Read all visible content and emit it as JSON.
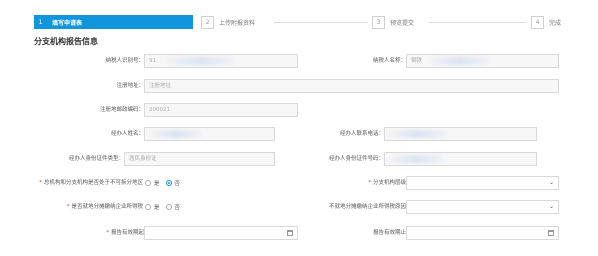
{
  "steps": [
    {
      "num": "1",
      "label": "填写申请表"
    },
    {
      "num": "2",
      "label": "上传附报资料"
    },
    {
      "num": "3",
      "label": "预览提交"
    },
    {
      "num": "4",
      "label": "完成"
    }
  ],
  "section_title": "分支机构报告信息",
  "fields": {
    "taxpayer_id": {
      "label": "纳税人识别号：",
      "prefix": "91"
    },
    "taxpayer_name": {
      "label": "纳税人名称：",
      "prefix": "钢铁"
    },
    "reg_address": {
      "label": "注册地址：",
      "placeholder": "注册地址"
    },
    "postal_code": {
      "label": "注册地邮政编码：",
      "value": "200021"
    },
    "agent_name": {
      "label": "经办人姓名："
    },
    "agent_phone": {
      "label": "经办人联系电话："
    },
    "agent_id_type": {
      "label": "经办人身份证件类型：",
      "value": "居民身份证"
    },
    "agent_id_no": {
      "label": "经办人身份证件号码："
    },
    "inseparable_area": {
      "label": "总机构和分支机构是否处于不可拆分地区",
      "opt_yes": "是",
      "opt_no": "否"
    },
    "branch_type": {
      "label": "分支机构层级"
    },
    "local_income": {
      "label": "是否就地分摊缴纳企业所得税",
      "opt_yes": "是",
      "opt_no": "否"
    },
    "no_local_reason": {
      "label": "不就地分摊缴纳企业所得税原因"
    },
    "valid_from": {
      "label": "报告有效期起"
    },
    "valid_to": {
      "label": "报告有效期止"
    }
  }
}
